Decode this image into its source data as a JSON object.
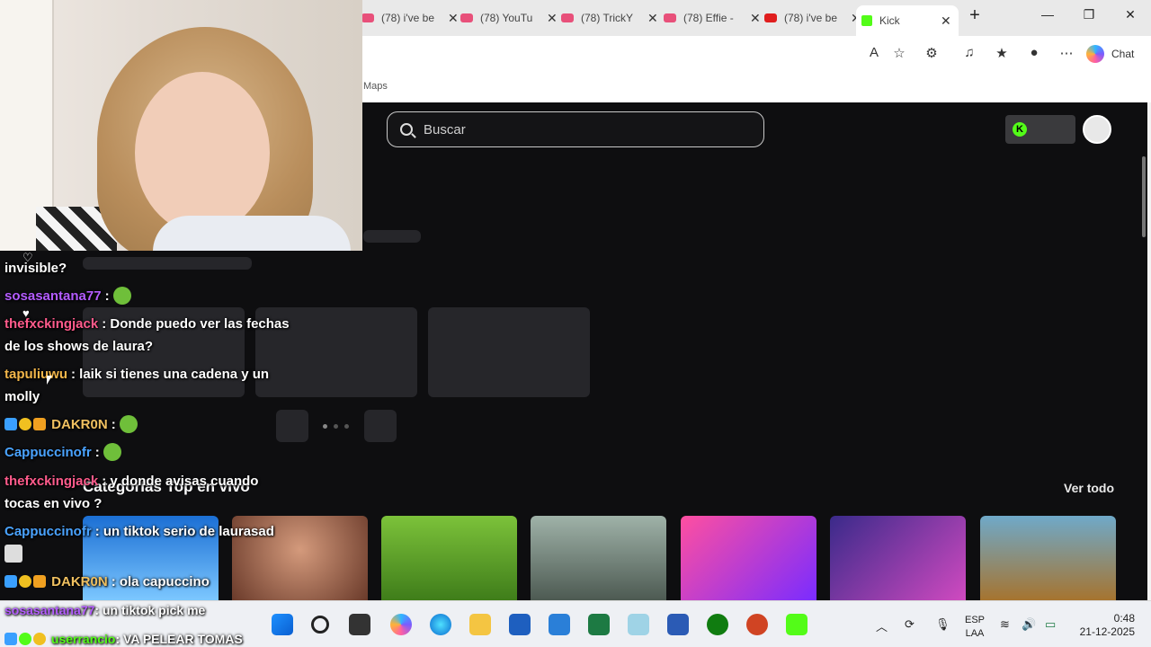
{
  "browser": {
    "tabs": [
      {
        "title": "(78) i've be",
        "color": "#e8507a"
      },
      {
        "title": "(78) YouTu",
        "color": "#e8507a"
      },
      {
        "title": "(78) TrickY",
        "color": "#e8507a"
      },
      {
        "title": "(78) Effie -",
        "color": "#e8507a"
      },
      {
        "title": "(78) i've be",
        "color": "#e01e1e"
      }
    ],
    "active_tab": {
      "title": "Kick",
      "color": "#53fc18"
    },
    "chat_label": "Chat",
    "bookmark_label": "Maps"
  },
  "page": {
    "search_placeholder": "Buscar",
    "section_title": "Categorías Top en vivo",
    "see_all": "Ver todo",
    "kick_logo": "K"
  },
  "chat": {
    "messages": [
      {
        "user": "",
        "text": "invisible?",
        "color": "#ffffff"
      },
      {
        "user": "sosasantana77",
        "text": ":",
        "color": "#b45cff",
        "emote": "pepe-emote"
      },
      {
        "user": "thefxckingjack",
        "text": ": Donde puedo ver las fechas de los shows de laura?",
        "color": "#ff5b8c"
      },
      {
        "user": "tapuliuwu",
        "text": ": laik si tienes una cadena y un molly",
        "color": "#f2b64a"
      },
      {
        "user": "DAKR0N",
        "text": ":",
        "color": "#f0c060",
        "emote": "pepe-emote"
      },
      {
        "user": "Cappuccinofr",
        "text": ":",
        "color": "#4aa3ff",
        "emote": "pepe-emote"
      },
      {
        "user": "thefxckingjack",
        "text": ": y donde avisas cuando tocas en vivo ?",
        "color": "#ff5b8c"
      },
      {
        "user": "Cappuccinofr",
        "text": ": un tiktok serio de laurasad",
        "color": "#4aa3ff"
      },
      {
        "user": "DAKR0N",
        "text": ": ola capuccino",
        "color": "#f0c060"
      }
    ],
    "bottom": [
      {
        "user": "sosasantana77",
        "text": ": un tiktok pick me",
        "color": "#b45cff"
      },
      {
        "user": "userrancio",
        "text": ": VA PELEAR TOMAS",
        "color": "#53fc18"
      }
    ]
  },
  "taskbar": {
    "lang_line1": "ESP",
    "lang_line2": "LAA",
    "time": "0:48",
    "date": "21-12-2025"
  }
}
